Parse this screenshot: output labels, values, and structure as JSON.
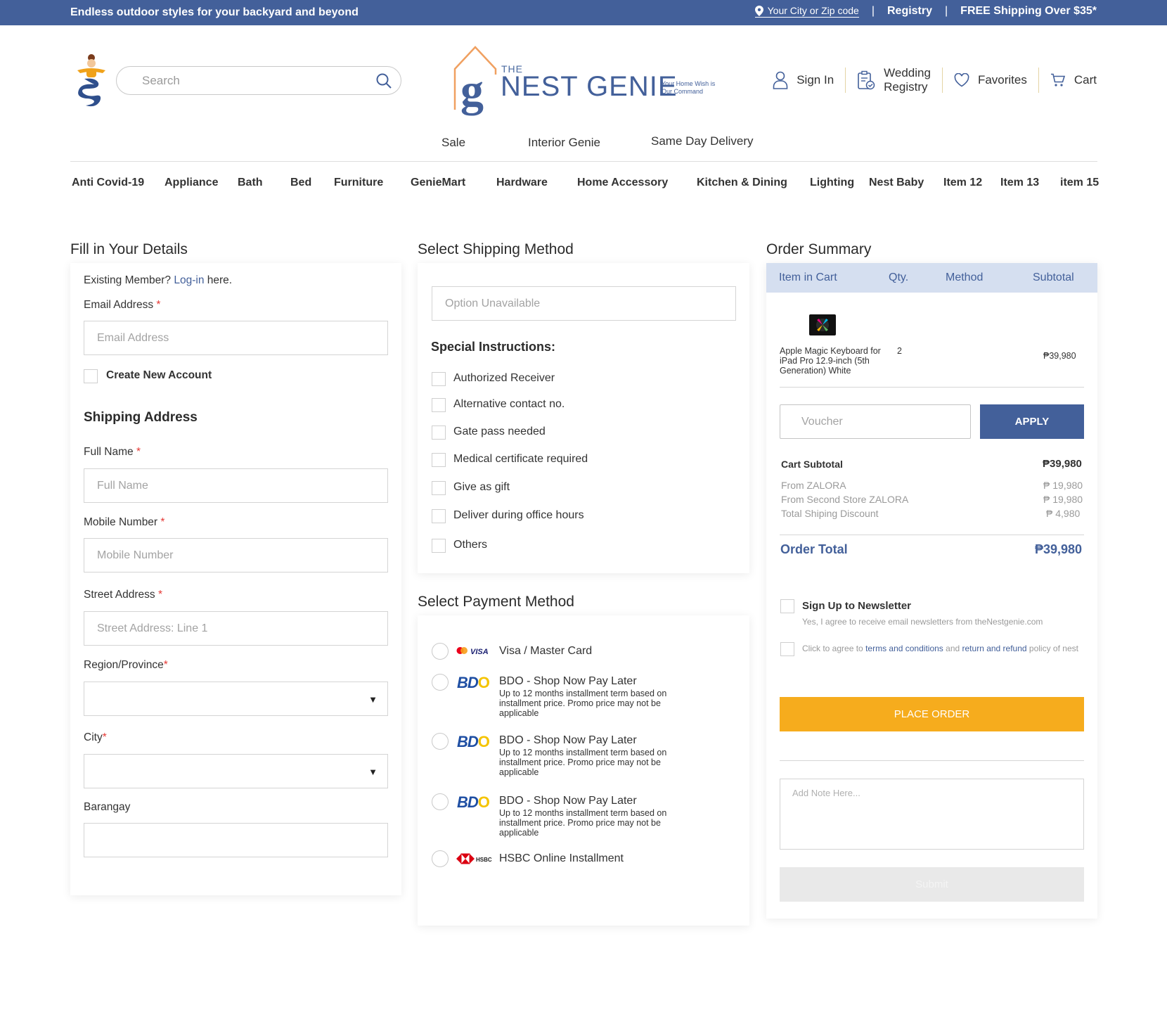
{
  "topbar": {
    "promo": "Endless outdoor styles for your backyard and beyond",
    "location_link": "Your City or Zip code",
    "separator": "|",
    "registry": "Registry",
    "free_shipping": "FREE Shipping Over $35*"
  },
  "header": {
    "search_placeholder": "Search",
    "logo_the": "THE",
    "logo_brand": "NEST GENIE",
    "logo_tagline": "Your Home Wish is Our Command",
    "sign_in": "Sign In",
    "wedding_line1": "Wedding",
    "wedding_line2": "Registry",
    "favorites": "Favorites",
    "cart": "Cart"
  },
  "subnav": [
    "Sale",
    "Interior Genie",
    "Same Day Delivery"
  ],
  "categories": [
    "Anti Covid-19",
    "Appliance",
    "Bath",
    "Bed",
    "Furniture",
    "GenieMart",
    "Hardware",
    "Home Accessory",
    "Kitchen & Dining",
    "Lighting",
    "Nest Baby",
    "Item 12",
    "Item 13",
    "item 15"
  ],
  "details": {
    "title": "Fill in Your Details",
    "existing": "Existing Member?",
    "login": "Log-in",
    "here": "here.",
    "email_label": "Email Address",
    "email_placeholder": "Email Address",
    "create_account": "Create New Account",
    "shipping_title": "Shipping Address",
    "fullname_label": "Full Name",
    "fullname_placeholder": "Full Name",
    "mobile_label": "Mobile Number",
    "mobile_placeholder": "Mobile Number",
    "street_label": "Street Address",
    "street_placeholder": "Street Address: Line 1",
    "region_label": "Region/Province",
    "city_label": "City",
    "barangay_label": "Barangay",
    "required_mark": "*",
    "caret": "▼"
  },
  "shipping": {
    "title": "Select Shipping Method",
    "option_placeholder": "Option Unavailable",
    "special_title": "Special Instructions:",
    "instructions": [
      "Authorized Receiver",
      "Alternative contact no.",
      "Gate pass needed",
      "Medical certificate required",
      "Give as gift",
      "Deliver during office hours",
      "Others"
    ]
  },
  "payment": {
    "title": "Select Payment Method",
    "visa_logo": "VISA",
    "visa_label": "Visa / Master Card",
    "bdo_logo": "BD",
    "bdo_logo_o": "O",
    "bdo_title": "BDO - Shop Now Pay Later",
    "bdo_desc": "Up to 12 months installment term based on installment price. Promo price may not be applicable",
    "hsbc_logo": "HSBC",
    "hsbc_label": "HSBC Online Installment"
  },
  "summary": {
    "title": "Order Summary",
    "col_item": "Item in Cart",
    "col_qty": "Qty.",
    "col_method": "Method",
    "col_subtotal": "Subtotal",
    "item_name": "Apple Magic Keyboard for iPad Pro 12.9-inch (5th Generation) White",
    "item_qty": "2",
    "item_subtotal": "₱39,980",
    "voucher_placeholder": "Voucher",
    "apply": "APPLY",
    "cart_subtotal_label": "Cart Subtotal",
    "cart_subtotal_value": "₱39,980",
    "from1_label": "From ZALORA",
    "from1_value": "₱ 19,980",
    "from2_label": "From Second Store ZALORA",
    "from2_value": "₱ 19,980",
    "discount_label": "Total Shiping Discount",
    "discount_value": "₱ 4,980",
    "order_total_label": "Order Total",
    "order_total_value": "₱39,980",
    "newsletter_label": "Sign Up to Newsletter",
    "newsletter_desc": "Yes, I agree to receive email newsletters from theNestgenie.com",
    "terms_pre": "Click to agree to",
    "terms_link": "terms and conditions",
    "terms_and": "and",
    "refund_link": "return and refund",
    "terms_post": "policy of nest",
    "place_order": "PLACE ORDER",
    "note_placeholder": "Add Note Here...",
    "submit": "Submit"
  },
  "colors": {
    "brand_blue": "#43609a",
    "header_band": "#d5dff0",
    "order_button": "#f6ac1d",
    "required": "#e53935"
  }
}
